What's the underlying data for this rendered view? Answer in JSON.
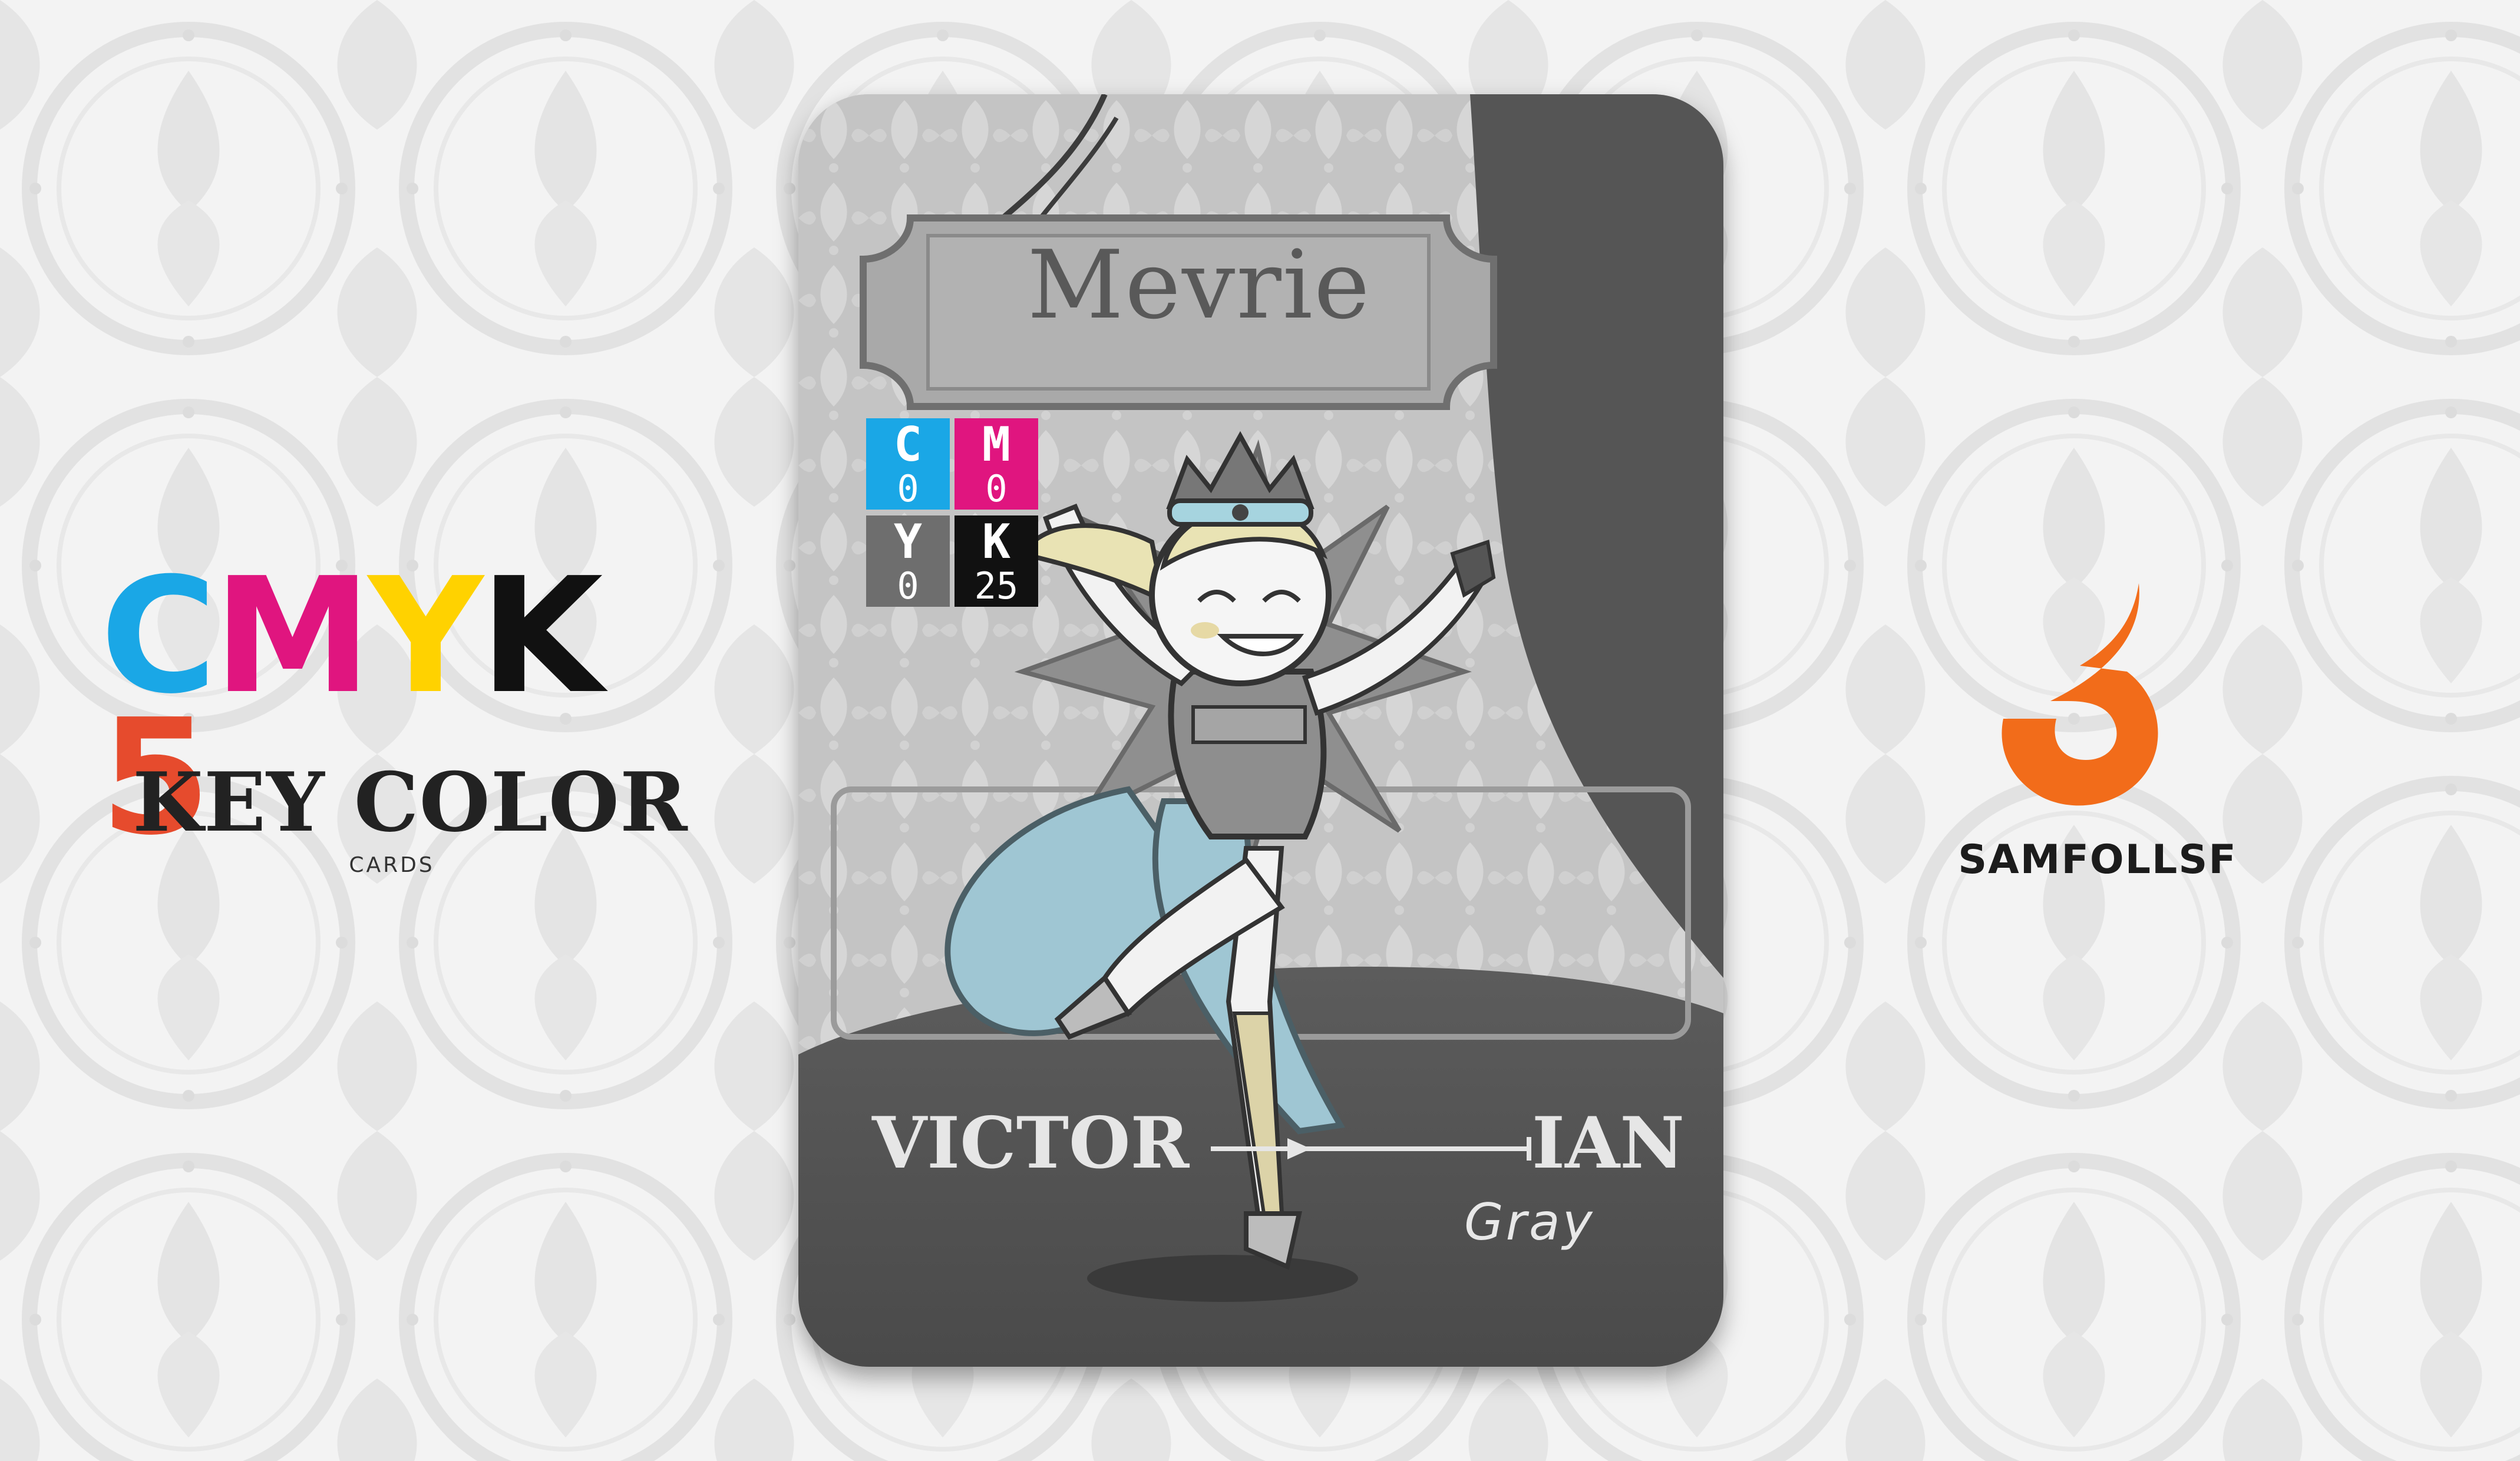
{
  "brand_left": {
    "logo_letters": [
      {
        "char": "C",
        "color": "#1aa7e6"
      },
      {
        "char": "M",
        "color": "#e0157f"
      },
      {
        "char": "Y",
        "color": "#ffd200"
      },
      {
        "char": "K",
        "color": "#111111"
      },
      {
        "char": "5",
        "color": "#e64b2d"
      }
    ],
    "title": "KEY COLOR",
    "subtitle": "CARDS"
  },
  "card": {
    "name": "Mevrie",
    "stamp": [
      {
        "letter": "C",
        "value": "0",
        "color": "#1aa7e6"
      },
      {
        "letter": "M",
        "value": "0",
        "color": "#e0157f"
      },
      {
        "letter": "Y",
        "value": "0",
        "color": "#6e6e6e"
      },
      {
        "letter": "K",
        "value": "25",
        "color": "#111111"
      }
    ],
    "footer_left": "VICTOR",
    "footer_right": "IAN",
    "footer_sub": "Gray",
    "base_color": "#bdbdbd"
  },
  "brand_right": {
    "name": "SAMFOLLSF",
    "icon": "orange-flame-logo-icon",
    "color": "#f26c1a"
  }
}
